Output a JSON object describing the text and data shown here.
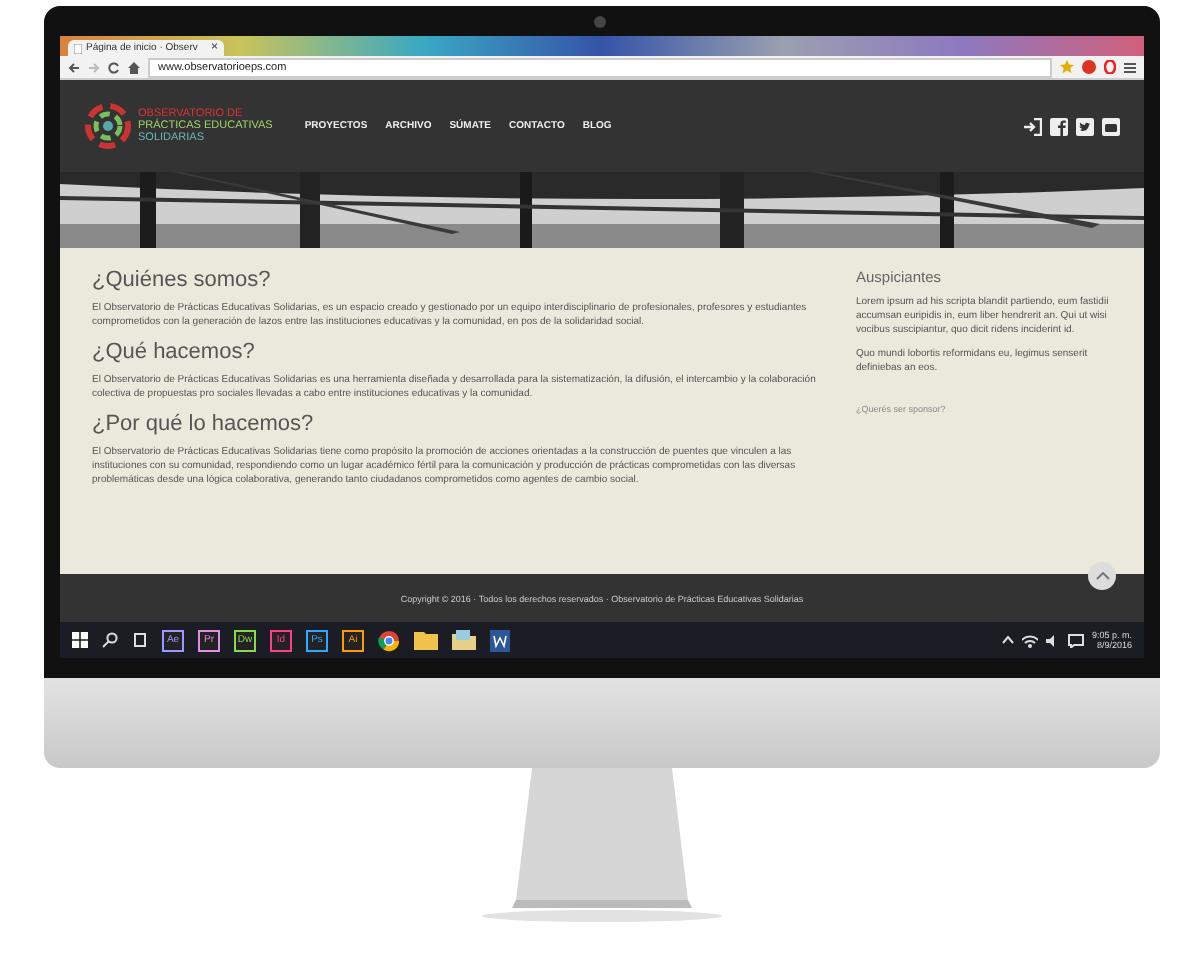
{
  "browser": {
    "tab_title": "Página de inicio · Observ",
    "tab_close": "×",
    "url": "www.observatorioeps.com"
  },
  "site": {
    "logo_lines": [
      "OBSERVATORIO DE",
      "PRÁCTICAS EDUCATIVAS",
      "SOLIDARIAS"
    ],
    "nav": [
      "PROYECTOS",
      "ARCHIVO",
      "SÚMATE",
      "CONTACTO",
      "BLOG"
    ]
  },
  "sections": [
    {
      "heading": "¿Quiénes somos?",
      "text": "El Observatorio de Prácticas Educativas Solidarias, es un espacio creado y gestionado por un equipo interdisciplinario de profesionales, profesores y estudiantes comprometidos con la generación de lazos entre las instituciones educativas y la comunidad, en pos de la solidaridad social."
    },
    {
      "heading": "¿Qué hacemos?",
      "text": "El Observatorio de Prácticas Educativas Solidarias es una herramienta diseñada y desarrollada para la sistematización, la difusión, el intercambio y la colaboración colectiva de propuestas pro sociales llevadas a cabo entre instituciones educativas y la comunidad."
    },
    {
      "heading": "¿Por qué lo hacemos?",
      "text": "El Observatorio de Prácticas Educativas Solidarias tiene como propósito la promoción de acciones orientadas a la construcción de puentes que vinculen a las instituciones con su comunidad, respondiendo como un lugar académico fértil para la comunicación y producción de prácticas comprometidas con las diversas problemáticas desde una lógica colaborativa, generando tanto ciudadanos comprometidos como agentes de cambio social."
    }
  ],
  "sidebar": {
    "heading": "Auspiciantes",
    "paragraphs": [
      "Lorem ipsum ad his scripta blandit partiendo, eum fastidii accumsan euripidis in, eum liber hendrerit an. Qui ut wisi vocibus suscipiantur, quo dicit ridens inciderint id.",
      "Quo mundi lobortis reformidans eu, legimus senserit definiebas an eos."
    ],
    "link": "¿Querés ser sponsor?"
  },
  "footer": "Copyright © 2016 · Todos los derechos reservados · Observatorio de Prácticas Educativas Solidarias",
  "taskbar": {
    "apps": [
      {
        "kind": "letters",
        "label": "Ae",
        "color": "#9999ff"
      },
      {
        "kind": "letters",
        "label": "Pr",
        "color": "#e38ee3"
      },
      {
        "kind": "letters",
        "label": "Dw",
        "color": "#8ad94a"
      },
      {
        "kind": "letters",
        "label": "Id",
        "color": "#ff3d8b"
      },
      {
        "kind": "letters",
        "label": "Ps",
        "color": "#31a8ff"
      },
      {
        "kind": "letters",
        "label": "Ai",
        "color": "#ff9a00"
      },
      {
        "kind": "chrome"
      },
      {
        "kind": "folder"
      },
      {
        "kind": "files"
      },
      {
        "kind": "word"
      }
    ],
    "time": "9:05 p. m.",
    "date": "8/9/2016"
  }
}
